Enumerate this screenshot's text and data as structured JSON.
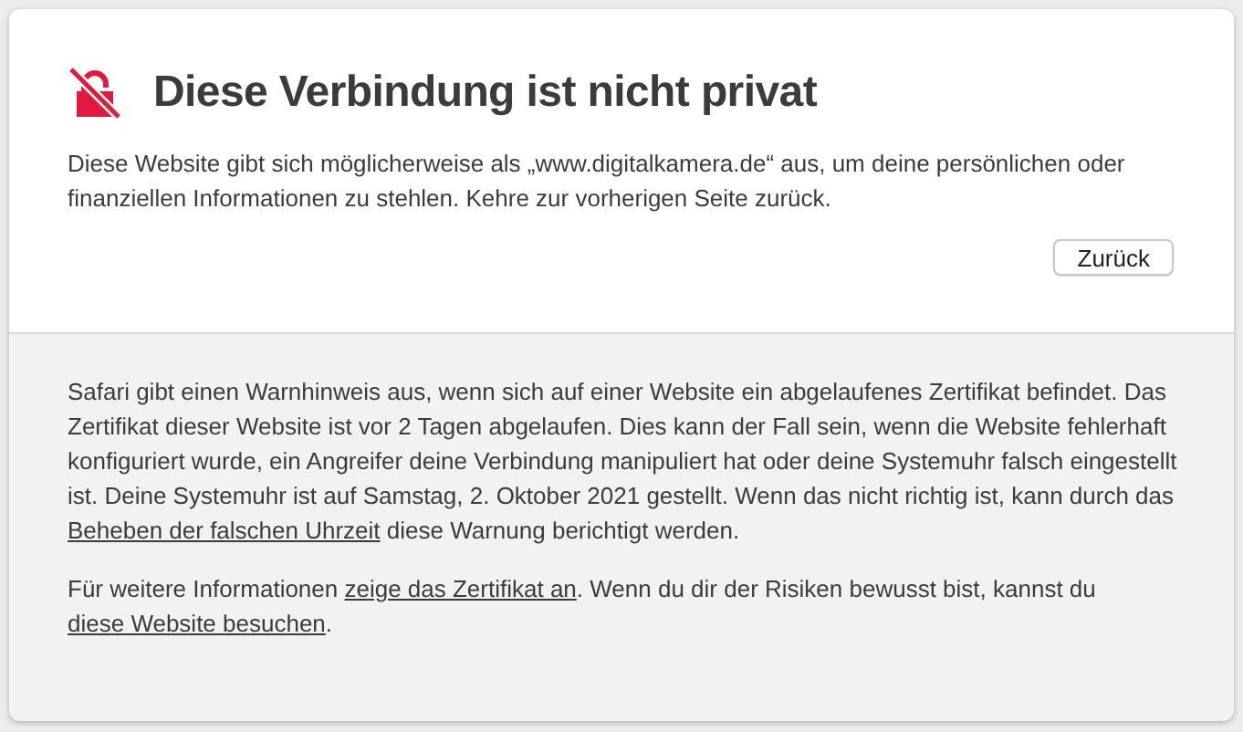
{
  "title": "Diese Verbindung ist nicht privat",
  "message": "Diese Website gibt sich möglicherweise als „www.digitalkamera.de“ aus, um deine persönlichen oder finanziellen Informationen zu stehlen. Kehre zur vorherigen Seite zurück.",
  "back_button": "Zurück",
  "details": [
    [
      {
        "kind": "text",
        "text": "Safari gibt einen Warnhinweis aus, wenn sich auf einer Website ein abgelaufenes Zertifikat befindet. Das Zertifikat dieser Website ist vor 2 Tagen abgelaufen. Dies kann der Fall sein, wenn die Website fehlerhaft konfiguriert wurde, ein Angreifer deine Verbindung manipuliert hat oder deine Systemuhr falsch eingestellt ist. Deine Systemuhr ist auf Samstag, 2. Oktober 2021 gestellt. Wenn das nicht richtig ist, kann durch das "
      },
      {
        "kind": "link",
        "text": "Beheben der falschen Uhrzeit"
      },
      {
        "kind": "text",
        "text": " diese Warnung berichtigt werden."
      }
    ],
    [
      {
        "kind": "text",
        "text": "Für weitere Informationen "
      },
      {
        "kind": "link",
        "text": "zeige das Zertifikat an"
      },
      {
        "kind": "text",
        "text": ". Wenn du dir der Risiken bewusst bist, kannst du "
      },
      {
        "kind": "link",
        "text": "diese Website besuchen"
      },
      {
        "kind": "text",
        "text": "."
      }
    ]
  ]
}
